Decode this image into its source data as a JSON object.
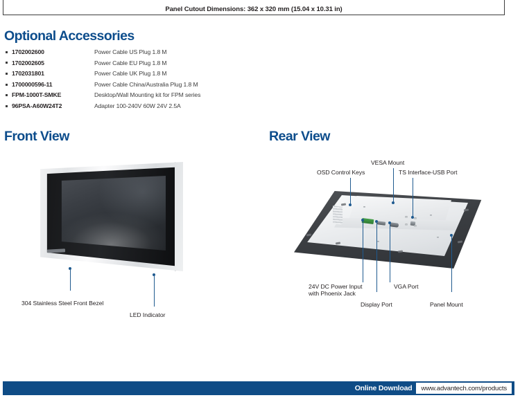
{
  "spec_box": {
    "title": "Panel Cutout Dimensions: 362 x 320 mm (15.04 x 10.31 in)"
  },
  "sections": {
    "optional_accessories_title": "Optional Accessories",
    "front_view_title": "Front View",
    "rear_view_title": "Rear View"
  },
  "accessories": [
    {
      "code": "1702002600",
      "description": "Power Cable US Plug 1.8 M"
    },
    {
      "code": "1702002605",
      "description": "Power Cable EU Plug 1.8 M"
    },
    {
      "code": "1702031801",
      "description": "Power Cable UK Plug 1.8 M"
    },
    {
      "code": "1700000596-11",
      "description": "Power Cable China/Australia Plug 1.8 M"
    },
    {
      "code": "FPM-1000T-SMKE",
      "description": "Desktop/Wall Mounting kit for FPM series"
    },
    {
      "code": "96PSA-A60W24T2",
      "description": "Adapter 100-240V 60W 24V 2.5A"
    }
  ],
  "front_view_callouts": [
    {
      "label": "304 Stainless Steel Front Bezel"
    },
    {
      "label": "LED Indicator"
    }
  ],
  "rear_view_callouts": [
    {
      "label": "OSD Control Keys"
    },
    {
      "label": "VESA Mount"
    },
    {
      "label": "TS Interface-USB Port"
    },
    {
      "label": "24V DC Power Input"
    },
    {
      "label": "with Phoenix Jack"
    },
    {
      "label": "VGA Port"
    },
    {
      "label": "Display Port"
    },
    {
      "label": "Panel Mount"
    }
  ],
  "footer": {
    "download_label": "Online Download",
    "url": "www.advantech.com/products"
  },
  "colors": {
    "brand_blue": "#0d4d8c",
    "footer_blue": "#0f4c86",
    "callout_blue": "#1f5a8f",
    "body_text": "#231f20"
  }
}
